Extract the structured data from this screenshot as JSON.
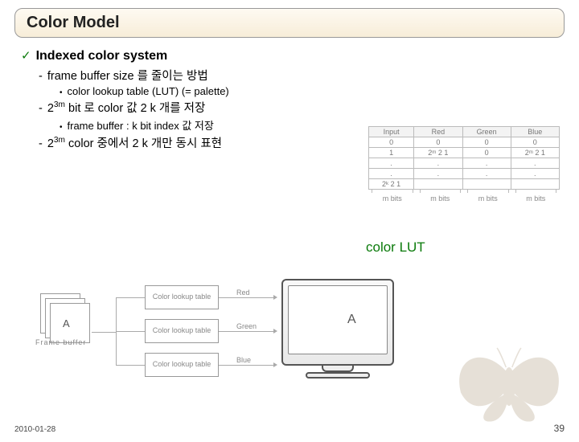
{
  "title": "Color Model",
  "bullets": {
    "l1": "Indexed color system",
    "l2a": "frame buffer size 를 줄이는 방법",
    "l3a": "color lookup table (LUT) (= palette)",
    "l2b_pre": "2",
    "l2b_sup": "3m",
    "l2b_post": " bit 로 color 값 2 k 개를 저장",
    "l3b": "frame buffer : k bit index 값 저장",
    "l2c_pre": "2",
    "l2c_sup": "3m",
    "l2c_post": " color 중에서 2 k 개만 동시 표현"
  },
  "lut": {
    "headers": [
      "Input",
      "Red",
      "Green",
      "Blue"
    ],
    "rows": [
      [
        "0",
        "0",
        "0",
        "0"
      ],
      [
        "1",
        "2ᵐ 2 1",
        "0",
        "2ᵐ 2 1"
      ],
      [
        ".",
        ".",
        ".",
        "."
      ],
      [
        ".",
        ".",
        ".",
        "."
      ],
      [
        "2ᵏ 2 1",
        "",
        "",
        ""
      ]
    ],
    "bits": [
      "m bits",
      "m bits",
      "m bits",
      "m bits"
    ]
  },
  "lut_caption": "color LUT",
  "figure": {
    "frame_buffer_label": "Frame buffer",
    "lut_box_label": "Color lookup table",
    "channels": {
      "r": "Red",
      "g": "Green",
      "b": "Blue"
    },
    "glyph": "A"
  },
  "footer": {
    "left": "2010-01-28",
    "right": "39"
  }
}
